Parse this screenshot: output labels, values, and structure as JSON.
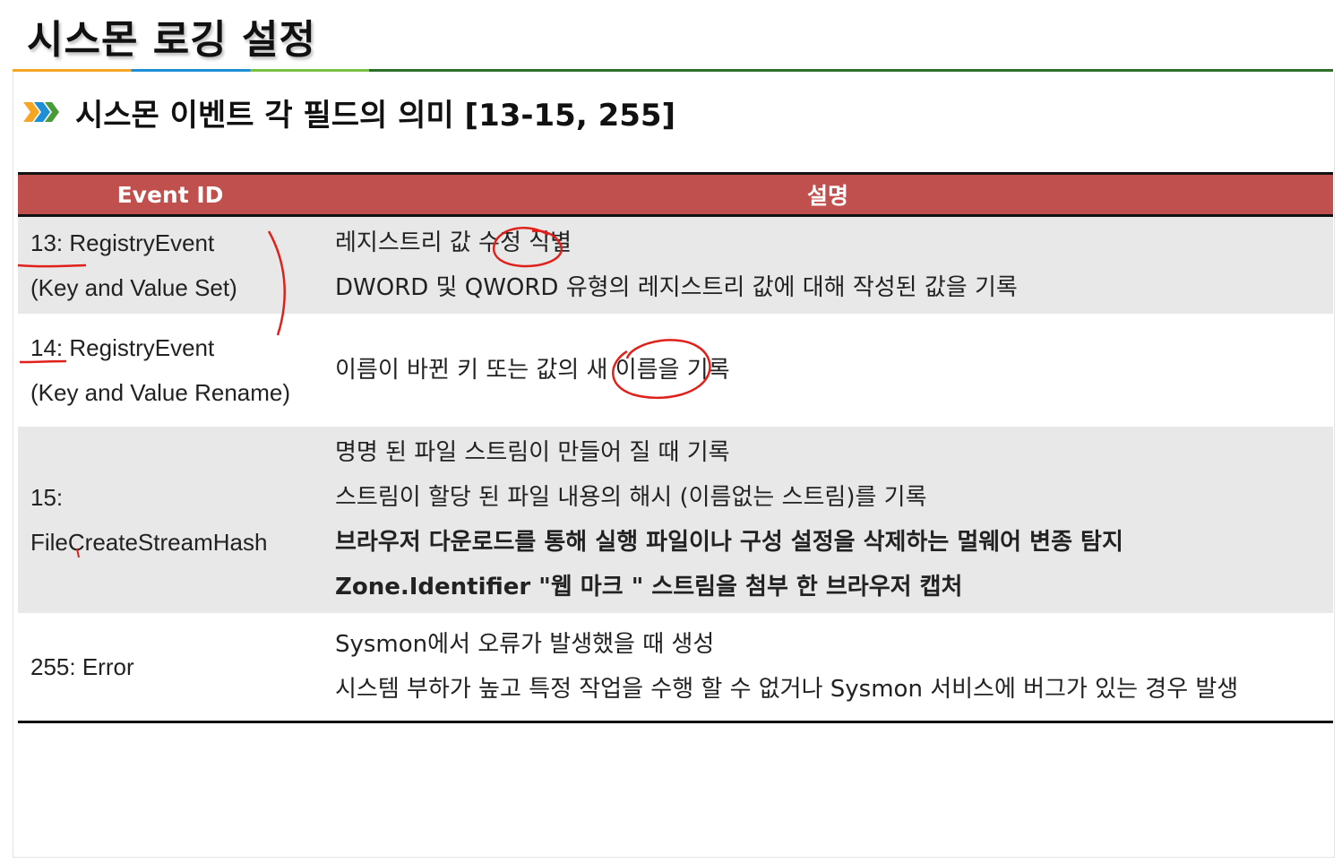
{
  "title": "시스몬 로깅 설정",
  "subtitle": "시스몬 이벤트 각 필드의 의미 [13-15, 255]",
  "colors": {
    "header_bg": "#c0504d",
    "row_shade": "#e8e8e8",
    "annotation": "#e0201b"
  },
  "table": {
    "headers": {
      "event_id": "Event ID",
      "description": "설명"
    },
    "rows": [
      {
        "id_lines": [
          "13: RegistryEvent",
          "(Key and Value Set)"
        ],
        "desc_lines": [
          "레지스트리 값 수정 식별",
          "DWORD 및 QWORD 유형의 레지스트리 값에 대해 작성된 값을 기록"
        ]
      },
      {
        "id_lines": [
          "14: RegistryEvent",
          "(Key and Value Rename)"
        ],
        "desc_lines": [
          "이름이 바뀐 키 또는 값의 새 이름을 기록"
        ]
      },
      {
        "id_lines": [
          "15:",
          "FileCreateStreamHash"
        ],
        "desc_lines": [
          "명명 된 파일 스트림이 만들어 질 때 기록",
          "스트림이 할당 된 파일 내용의 해시 (이름없는 스트림)를 기록",
          "브라우저 다운로드를 통해 실행 파일이나 구성 설정을 삭제하는 멀웨어 변종 탐지",
          "Zone.Identifier \"웹 마크 \"  스트림을 첨부 한 브라우저 캡처"
        ]
      },
      {
        "id_lines": [
          "255: Error"
        ],
        "desc_lines": [
          "Sysmon에서 오류가 발생했을 때 생성",
          "시스템 부하가 높고 특정 작업을 수행 할 수 없거나 Sysmon 서비스에 버그가 있는 경우 발생"
        ]
      }
    ]
  }
}
